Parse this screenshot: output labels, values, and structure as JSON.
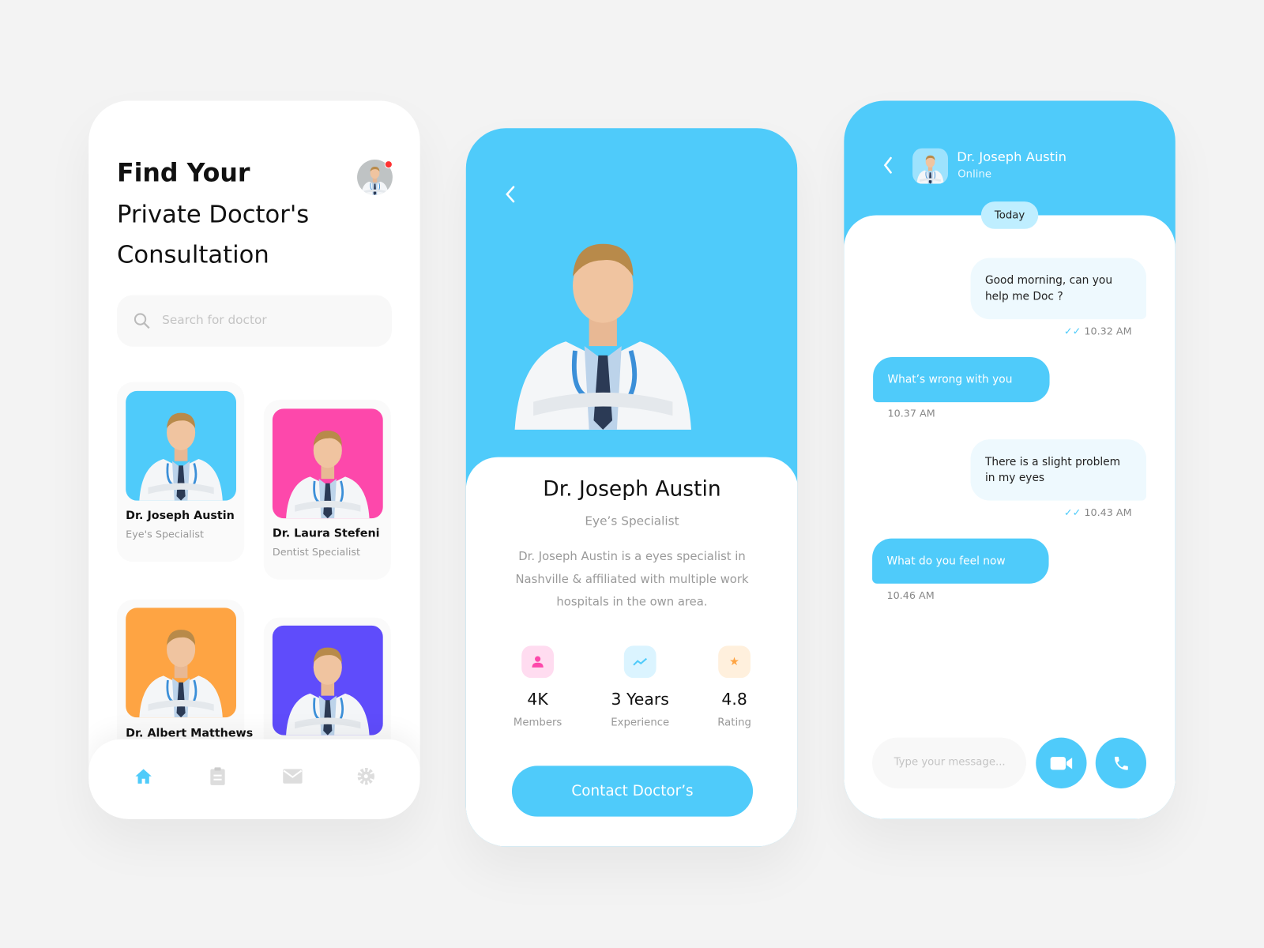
{
  "colors": {
    "accent": "#4fcbfa",
    "pink": "#fd48ab",
    "orange": "#fea443",
    "purple": "#5f4cfb",
    "notification": "#f33"
  },
  "home": {
    "title_bold": "Find Your",
    "title_line2": "Private Doctor's",
    "title_line3": "Consultation",
    "search_placeholder": "Search for doctor",
    "doctors": [
      {
        "name": "Dr. Joseph Austin",
        "specialty": "Eye's Specialist",
        "bg": "#4fcbfa"
      },
      {
        "name": "Dr. Laura Stefeni",
        "specialty": "Dentist Specialist",
        "bg": "#fd48ab"
      },
      {
        "name": "Dr. Albert Matthews",
        "specialty": "",
        "bg": "#fea443"
      },
      {
        "name": "",
        "specialty": "",
        "bg": "#5f4cfb"
      }
    ],
    "nav": [
      "home-icon",
      "clipboard-icon",
      "mail-icon",
      "gear-icon"
    ]
  },
  "profile": {
    "name": "Dr. Joseph Austin",
    "specialty": "Eye’s Specialist",
    "description": "Dr. Joseph Austin is a eyes specialist in Nashville & affiliated with multiple work hospitals in the own area.",
    "stats": [
      {
        "value": "4K",
        "label": "Members",
        "icon": "user-icon"
      },
      {
        "value": "3 Years",
        "label": "Experience",
        "icon": "trend-icon"
      },
      {
        "value": "4.8",
        "label": "Rating",
        "icon": "star-icon"
      }
    ],
    "contact_label": "Contact Doctor’s"
  },
  "chat": {
    "name": "Dr. Joseph Austin",
    "status": "Online",
    "day": "Today",
    "messages": [
      {
        "dir": "out",
        "text": "Good morning, can you help me Doc ?",
        "time": "10.32 AM"
      },
      {
        "dir": "in",
        "text": "What’s wrong with you",
        "time": "10.37 AM"
      },
      {
        "dir": "out",
        "text": "There is a slight problem in my eyes",
        "time": "10.43 AM"
      },
      {
        "dir": "in",
        "text": "What do you feel now",
        "time": "10.46 AM"
      }
    ],
    "input_placeholder": "Type your message..."
  }
}
